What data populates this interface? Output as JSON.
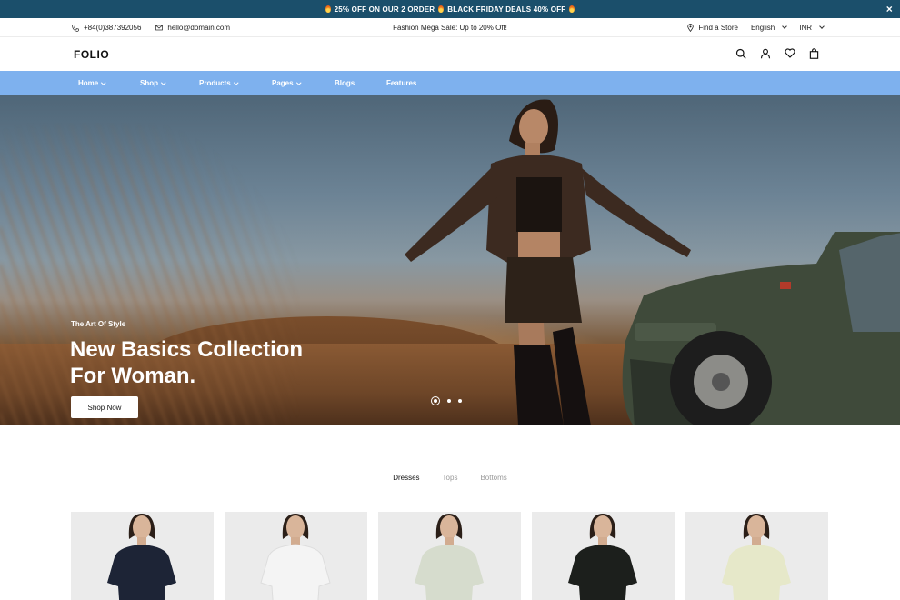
{
  "announcement": {
    "text_1": "25% OFF ON OUR 2 ORDER",
    "text_2": "BLACK FRIDAY DEALS 40% OFF",
    "close_symbol": "×"
  },
  "topbar": {
    "phone": "+84(0)387392056",
    "email": "hello@domain.com",
    "promo": "Fashion Mega Sale: Up to 20% Off!",
    "store_link": "Find a Store",
    "language": "English",
    "currency": "INR"
  },
  "header": {
    "logo": "FOLIO",
    "icons": [
      "search-icon",
      "user-icon",
      "heart-icon",
      "bag-icon"
    ]
  },
  "nav": {
    "items": [
      {
        "label": "Home",
        "dropdown": true
      },
      {
        "label": "Shop",
        "dropdown": true
      },
      {
        "label": "Products",
        "dropdown": true
      },
      {
        "label": "Pages",
        "dropdown": true
      },
      {
        "label": "Blogs",
        "dropdown": false
      },
      {
        "label": "Features",
        "dropdown": false
      }
    ]
  },
  "hero": {
    "subtitle": "The Art Of Style",
    "title_line1": "New Basics Collection",
    "title_line2": "For Woman.",
    "button": "Shop Now",
    "slides": 3,
    "active_slide": 1
  },
  "tabs": {
    "items": [
      "Dresses",
      "Tops",
      "Bottoms"
    ],
    "active": "Dresses"
  },
  "products": [
    {
      "outfit_color": "#1d2436"
    },
    {
      "outfit_color": "#f4f4f4"
    },
    {
      "outfit_color": "#d6dccd"
    },
    {
      "outfit_color": "#1c1f1c"
    },
    {
      "outfit_color": "#e6e8c9"
    }
  ],
  "colors": {
    "announce_bg": "#1b4f6b",
    "nav_bg": "#7eb1ee"
  }
}
